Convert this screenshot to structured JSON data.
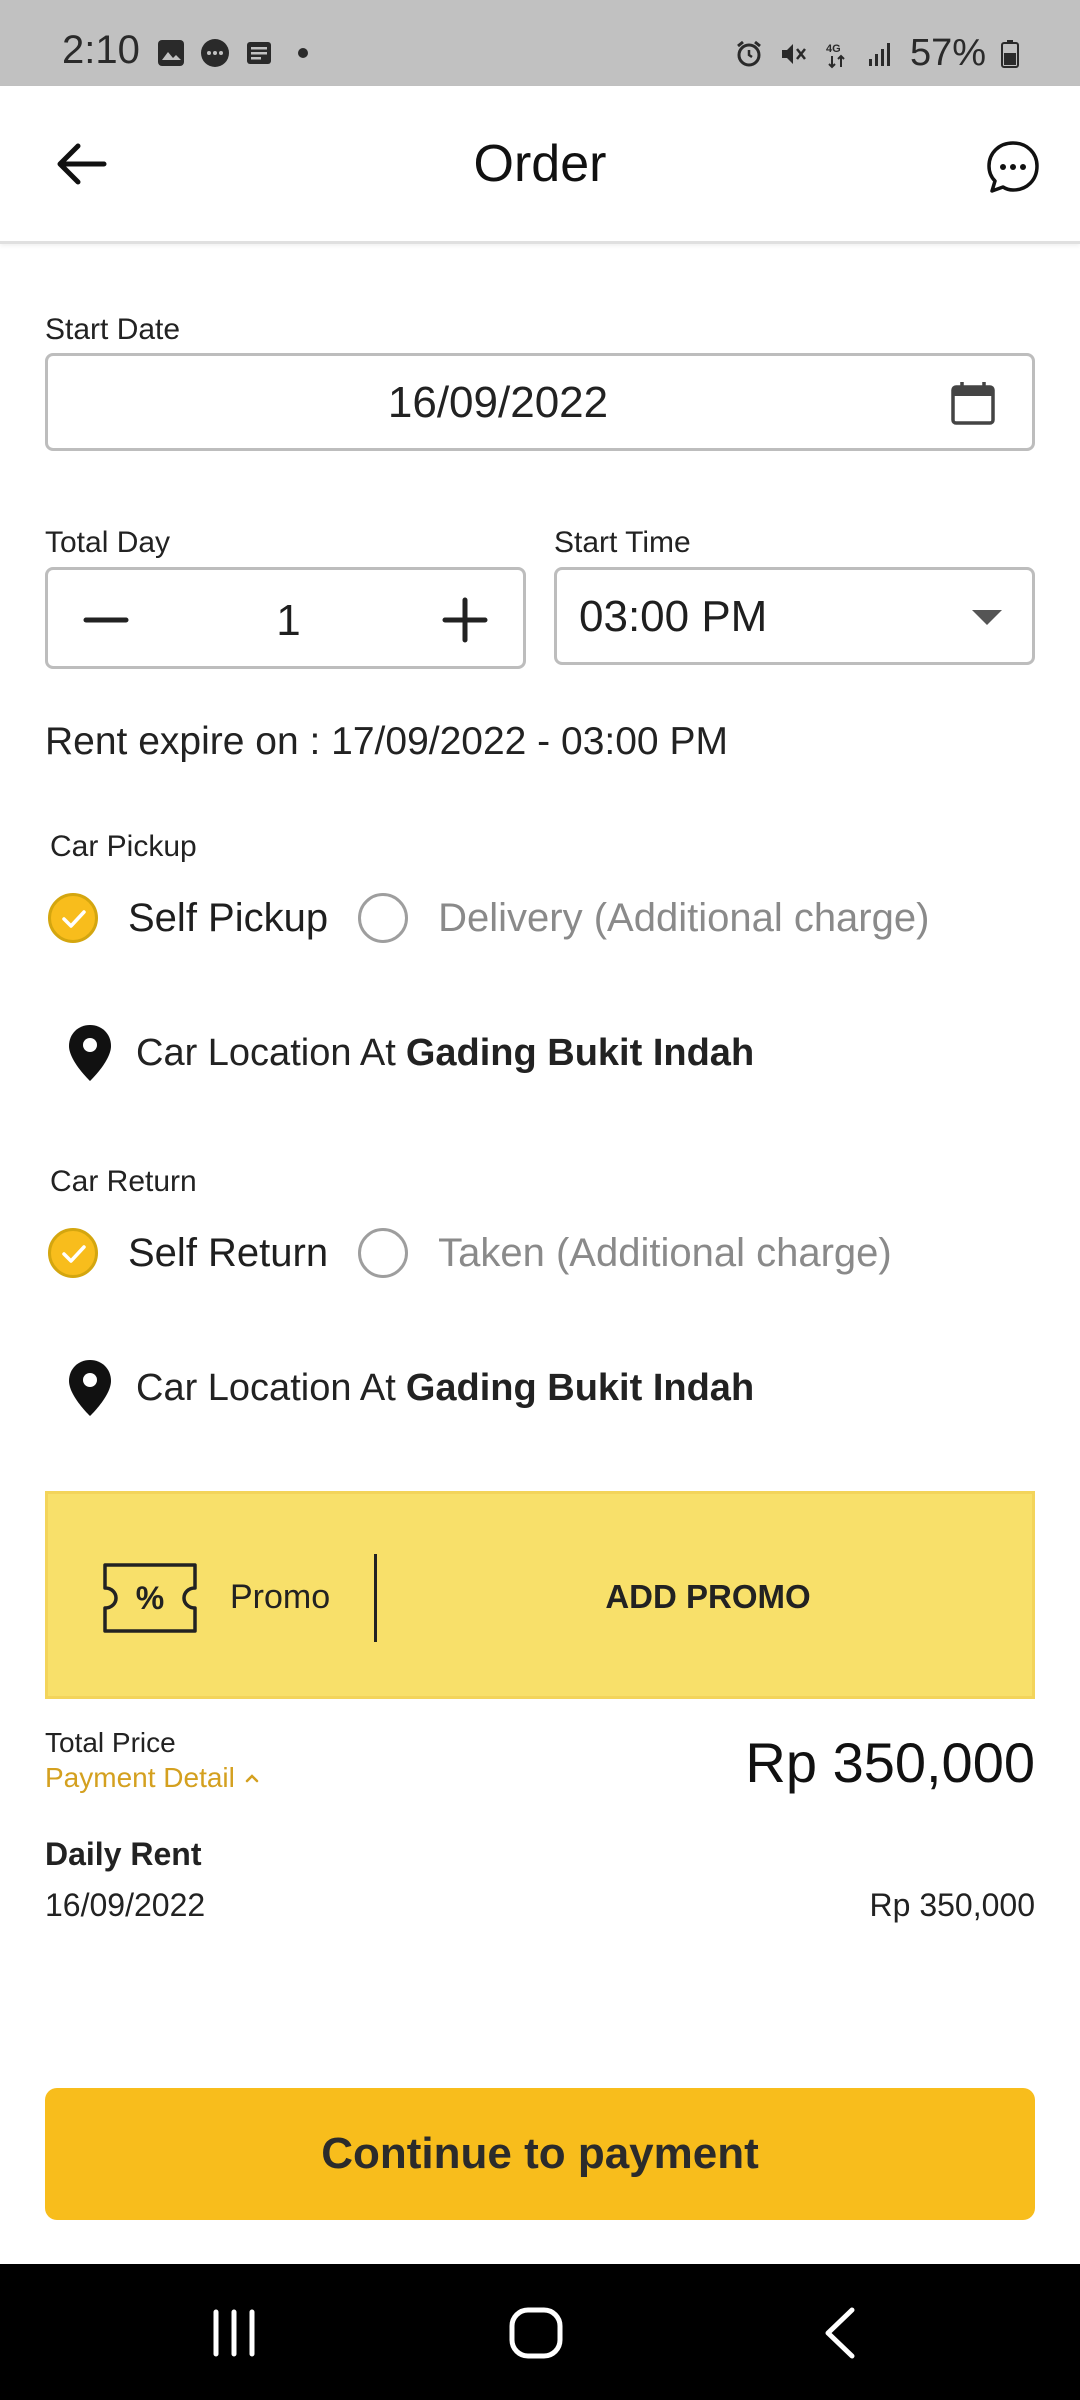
{
  "status_bar": {
    "time": "2:10",
    "battery": "57%",
    "network": "4G"
  },
  "app_bar": {
    "title": "Order"
  },
  "start_date": {
    "label": "Start Date",
    "value": "16/09/2022"
  },
  "total_day": {
    "label": "Total Day",
    "value": "1"
  },
  "start_time": {
    "label": "Start Time",
    "value": "03:00 PM"
  },
  "expire_text": "Rent expire on : 17/09/2022 - 03:00 PM",
  "car_pickup": {
    "label": "Car Pickup",
    "options": [
      {
        "label": "Self Pickup",
        "selected": true
      },
      {
        "label": "Delivery (Additional charge)",
        "selected": false
      }
    ],
    "location_prefix": "Car Location At",
    "location_name": "Gading Bukit Indah"
  },
  "car_return": {
    "label": "Car Return",
    "options": [
      {
        "label": "Self Return",
        "selected": true
      },
      {
        "label": "Taken (Additional charge)",
        "selected": false
      }
    ],
    "location_prefix": "Car Location At",
    "location_name": "Gading Bukit Indah"
  },
  "promo": {
    "label": "Promo",
    "action": "ADD PROMO"
  },
  "total": {
    "label": "Total Price",
    "detail_link": "Payment Detail",
    "value": "Rp 350,000"
  },
  "daily_rent": {
    "label": "Daily Rent",
    "date": "16/09/2022",
    "price": "Rp 350,000"
  },
  "cta": {
    "label": "Continue to payment"
  },
  "colors": {
    "accent": "#f8bd1c",
    "promo_bg": "#f8e06a",
    "link": "#d4a01f"
  }
}
